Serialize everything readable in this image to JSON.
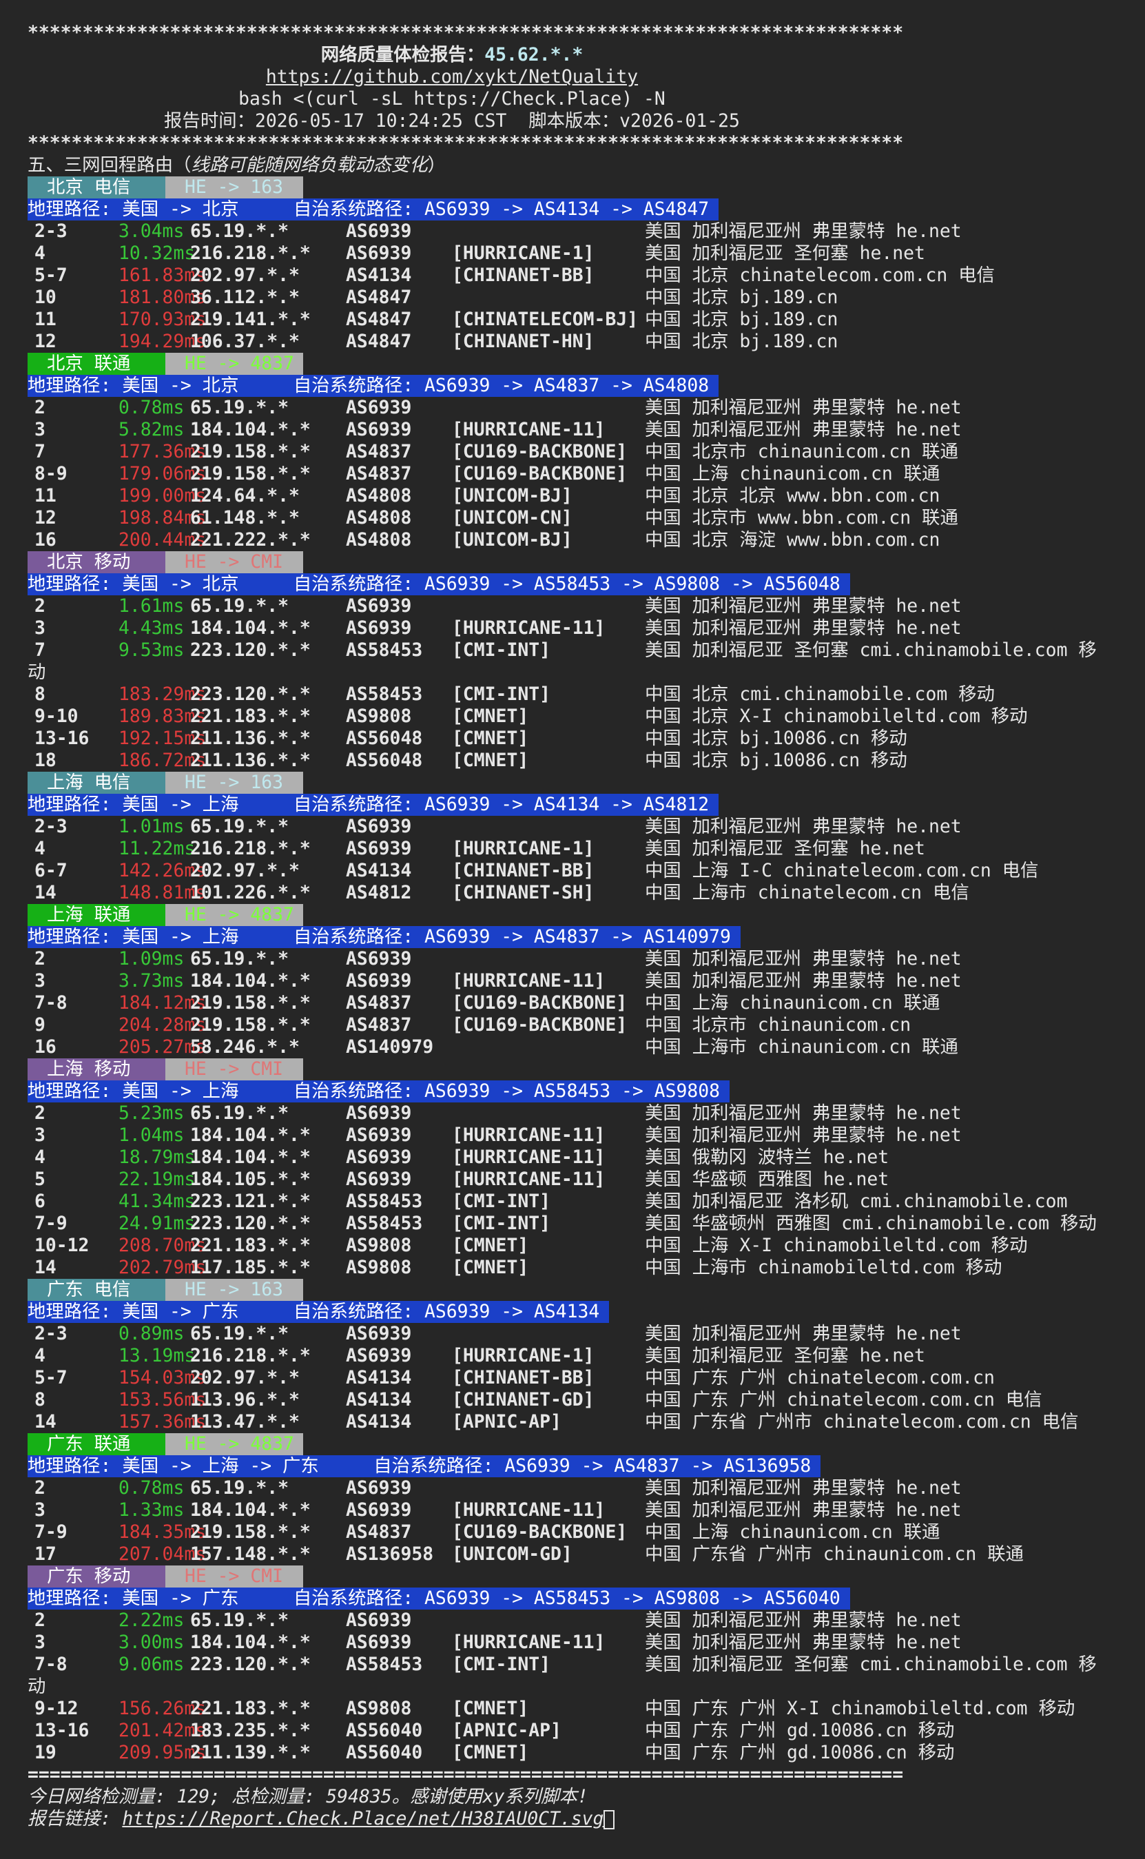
{
  "header": {
    "stars": "********************************************************************************",
    "title_label": "网络质量体检报告：",
    "title_ip": "45.62.*.*",
    "repo_link": "https://github.com/xykt/NetQuality",
    "command": "bash <(curl -sL https://Check.Place) -N",
    "report_time_label": "报告时间：",
    "report_time": "2026-05-17 10:24:25 CST",
    "script_version_label": "脚本版本：",
    "script_version": "v2026-01-25",
    "section_title": "五、三网回程路由（",
    "section_title_note": "线路可能随网络负载动态变化",
    "section_title_end": "）"
  },
  "routes": [
    {
      "location": "北京 电信",
      "isp": "HE -> 163",
      "type": "dx",
      "path": "地理路径: 美国 -> 北京     自治系统路径: AS6939 -> AS4134 -> AS4847",
      "hops": [
        {
          "hop": "2-3",
          "lat": "3.04ms",
          "hi": false,
          "ip": "65.19.*.*",
          "asn": "AS6939",
          "tag": "",
          "geo": "美国 加利福尼亚州 弗里蒙特 he.net"
        },
        {
          "hop": "4",
          "lat": "10.32ms",
          "hi": false,
          "ip": "216.218.*.*",
          "asn": "AS6939",
          "tag": "[HURRICANE-1]",
          "geo": "美国 加利福尼亚 圣何塞 he.net"
        },
        {
          "hop": "5-7",
          "lat": "161.83ms",
          "hi": true,
          "ip": "202.97.*.*",
          "asn": "AS4134",
          "tag": "[CHINANET-BB]",
          "geo": "中国 北京 chinatelecom.com.cn 电信"
        },
        {
          "hop": "10",
          "lat": "181.80ms",
          "hi": true,
          "ip": "36.112.*.*",
          "asn": "AS4847",
          "tag": "",
          "geo": "中国 北京 bj.189.cn"
        },
        {
          "hop": "11",
          "lat": "170.93ms",
          "hi": true,
          "ip": "219.141.*.*",
          "asn": "AS4847",
          "tag": "[CHINATELECOM-BJ]",
          "geo": "中国 北京 bj.189.cn"
        },
        {
          "hop": "12",
          "lat": "194.29ms",
          "hi": true,
          "ip": "106.37.*.*",
          "asn": "AS4847",
          "tag": "[CHINANET-HN]",
          "geo": "中国 北京 bj.189.cn"
        }
      ]
    },
    {
      "location": "北京 联通",
      "isp": "HE -> 4837",
      "type": "lt",
      "path": "地理路径: 美国 -> 北京     自治系统路径: AS6939 -> AS4837 -> AS4808",
      "hops": [
        {
          "hop": "2",
          "lat": "0.78ms",
          "hi": false,
          "ip": "65.19.*.*",
          "asn": "AS6939",
          "tag": "",
          "geo": "美国 加利福尼亚州 弗里蒙特 he.net"
        },
        {
          "hop": "3",
          "lat": "5.82ms",
          "hi": false,
          "ip": "184.104.*.*",
          "asn": "AS6939",
          "tag": "[HURRICANE-11]",
          "geo": "美国 加利福尼亚州 弗里蒙特 he.net"
        },
        {
          "hop": "7",
          "lat": "177.36ms",
          "hi": true,
          "ip": "219.158.*.*",
          "asn": "AS4837",
          "tag": "[CU169-BACKBONE]",
          "geo": "中国 北京市 chinaunicom.cn 联通"
        },
        {
          "hop": "8-9",
          "lat": "179.06ms",
          "hi": true,
          "ip": "219.158.*.*",
          "asn": "AS4837",
          "tag": "[CU169-BACKBONE]",
          "geo": "中国 上海 chinaunicom.cn 联通"
        },
        {
          "hop": "11",
          "lat": "199.00ms",
          "hi": true,
          "ip": "124.64.*.*",
          "asn": "AS4808",
          "tag": "[UNICOM-BJ]",
          "geo": "中国 北京 北京 www.bbn.com.cn"
        },
        {
          "hop": "12",
          "lat": "198.84ms",
          "hi": true,
          "ip": "61.148.*.*",
          "asn": "AS4808",
          "tag": "[UNICOM-CN]",
          "geo": "中国 北京市 www.bbn.com.cn 联通"
        },
        {
          "hop": "16",
          "lat": "200.44ms",
          "hi": true,
          "ip": "221.222.*.*",
          "asn": "AS4808",
          "tag": "[UNICOM-BJ]",
          "geo": "中国 北京 海淀 www.bbn.com.cn"
        }
      ]
    },
    {
      "location": "北京 移动",
      "isp": "HE -> CMI",
      "type": "yd",
      "path": "地理路径: 美国 -> 北京     自治系统路径: AS6939 -> AS58453 -> AS9808 -> AS56048",
      "hops": [
        {
          "hop": "2",
          "lat": "1.61ms",
          "hi": false,
          "ip": "65.19.*.*",
          "asn": "AS6939",
          "tag": "",
          "geo": "美国 加利福尼亚州 弗里蒙特 he.net"
        },
        {
          "hop": "3",
          "lat": "4.43ms",
          "hi": false,
          "ip": "184.104.*.*",
          "asn": "AS6939",
          "tag": "[HURRICANE-11]",
          "geo": "美国 加利福尼亚州 弗里蒙特 he.net"
        },
        {
          "hop": "7",
          "lat": "9.53ms",
          "hi": false,
          "ip": "223.120.*.*",
          "asn": "AS58453",
          "tag": "[CMI-INT]",
          "geo": "美国 加利福尼亚 圣何塞 cmi.chinamobile.com 移",
          "wrap": "动"
        },
        {
          "hop": "8",
          "lat": "183.29ms",
          "hi": true,
          "ip": "223.120.*.*",
          "asn": "AS58453",
          "tag": "[CMI-INT]",
          "geo": "中国 北京 cmi.chinamobile.com 移动"
        },
        {
          "hop": "9-10",
          "lat": "189.83ms",
          "hi": true,
          "ip": "221.183.*.*",
          "asn": "AS9808",
          "tag": "[CMNET]",
          "geo": "中国 北京 X-I chinamobileltd.com 移动"
        },
        {
          "hop": "13-16",
          "lat": "192.15ms",
          "hi": true,
          "ip": "211.136.*.*",
          "asn": "AS56048",
          "tag": "[CMNET]",
          "geo": "中国 北京 bj.10086.cn 移动"
        },
        {
          "hop": "18",
          "lat": "186.72ms",
          "hi": true,
          "ip": "211.136.*.*",
          "asn": "AS56048",
          "tag": "[CMNET]",
          "geo": "中国 北京 bj.10086.cn 移动"
        }
      ]
    },
    {
      "location": "上海 电信",
      "isp": "HE -> 163",
      "type": "dx",
      "path": "地理路径: 美国 -> 上海     自治系统路径: AS6939 -> AS4134 -> AS4812",
      "hops": [
        {
          "hop": "2-3",
          "lat": "1.01ms",
          "hi": false,
          "ip": "65.19.*.*",
          "asn": "AS6939",
          "tag": "",
          "geo": "美国 加利福尼亚州 弗里蒙特 he.net"
        },
        {
          "hop": "4",
          "lat": "11.22ms",
          "hi": false,
          "ip": "216.218.*.*",
          "asn": "AS6939",
          "tag": "[HURRICANE-1]",
          "geo": "美国 加利福尼亚 圣何塞 he.net"
        },
        {
          "hop": "6-7",
          "lat": "142.26ms",
          "hi": true,
          "ip": "202.97.*.*",
          "asn": "AS4134",
          "tag": "[CHINANET-BB]",
          "geo": "中国 上海 I-C chinatelecom.com.cn 电信"
        },
        {
          "hop": "14",
          "lat": "148.81ms",
          "hi": true,
          "ip": "101.226.*.*",
          "asn": "AS4812",
          "tag": "[CHINANET-SH]",
          "geo": "中国 上海市 chinatelecom.cn 电信"
        }
      ]
    },
    {
      "location": "上海 联通",
      "isp": "HE -> 4837",
      "type": "lt",
      "path": "地理路径: 美国 -> 上海     自治系统路径: AS6939 -> AS4837 -> AS140979",
      "hops": [
        {
          "hop": "2",
          "lat": "1.09ms",
          "hi": false,
          "ip": "65.19.*.*",
          "asn": "AS6939",
          "tag": "",
          "geo": "美国 加利福尼亚州 弗里蒙特 he.net"
        },
        {
          "hop": "3",
          "lat": "3.73ms",
          "hi": false,
          "ip": "184.104.*.*",
          "asn": "AS6939",
          "tag": "[HURRICANE-11]",
          "geo": "美国 加利福尼亚州 弗里蒙特 he.net"
        },
        {
          "hop": "7-8",
          "lat": "184.12ms",
          "hi": true,
          "ip": "219.158.*.*",
          "asn": "AS4837",
          "tag": "[CU169-BACKBONE]",
          "geo": "中国 上海 chinaunicom.cn 联通"
        },
        {
          "hop": "9",
          "lat": "204.28ms",
          "hi": true,
          "ip": "219.158.*.*",
          "asn": "AS4837",
          "tag": "[CU169-BACKBONE]",
          "geo": "中国 北京市 chinaunicom.cn"
        },
        {
          "hop": "16",
          "lat": "205.27ms",
          "hi": true,
          "ip": "58.246.*.*",
          "asn": "AS140979",
          "tag": "",
          "geo": "中国 上海市 chinaunicom.cn 联通"
        }
      ]
    },
    {
      "location": "上海 移动",
      "isp": "HE -> CMI",
      "type": "yd",
      "path": "地理路径: 美国 -> 上海     自治系统路径: AS6939 -> AS58453 -> AS9808",
      "hops": [
        {
          "hop": "2",
          "lat": "5.23ms",
          "hi": false,
          "ip": "65.19.*.*",
          "asn": "AS6939",
          "tag": "",
          "geo": "美国 加利福尼亚州 弗里蒙特 he.net"
        },
        {
          "hop": "3",
          "lat": "1.04ms",
          "hi": false,
          "ip": "184.104.*.*",
          "asn": "AS6939",
          "tag": "[HURRICANE-11]",
          "geo": "美国 加利福尼亚州 弗里蒙特 he.net"
        },
        {
          "hop": "4",
          "lat": "18.79ms",
          "hi": false,
          "ip": "184.104.*.*",
          "asn": "AS6939",
          "tag": "[HURRICANE-11]",
          "geo": "美国 俄勒冈 波特兰 he.net"
        },
        {
          "hop": "5",
          "lat": "22.19ms",
          "hi": false,
          "ip": "184.105.*.*",
          "asn": "AS6939",
          "tag": "[HURRICANE-11]",
          "geo": "美国 华盛顿 西雅图 he.net"
        },
        {
          "hop": "6",
          "lat": "41.34ms",
          "hi": false,
          "ip": "223.121.*.*",
          "asn": "AS58453",
          "tag": "[CMI-INT]",
          "geo": "美国 加利福尼亚 洛杉矶 cmi.chinamobile.com"
        },
        {
          "hop": "7-9",
          "lat": "24.91ms",
          "hi": false,
          "ip": "223.120.*.*",
          "asn": "AS58453",
          "tag": "[CMI-INT]",
          "geo": "美国 华盛顿州 西雅图 cmi.chinamobile.com 移动"
        },
        {
          "hop": "10-12",
          "lat": "208.70ms",
          "hi": true,
          "ip": "221.183.*.*",
          "asn": "AS9808",
          "tag": "[CMNET]",
          "geo": "中国 上海 X-I chinamobileltd.com 移动"
        },
        {
          "hop": "14",
          "lat": "202.79ms",
          "hi": true,
          "ip": "117.185.*.*",
          "asn": "AS9808",
          "tag": "[CMNET]",
          "geo": "中国 上海市 chinamobileltd.com 移动"
        }
      ]
    },
    {
      "location": "广东 电信",
      "isp": "HE -> 163",
      "type": "dx",
      "path": "地理路径: 美国 -> 广东     自治系统路径: AS6939 -> AS4134",
      "hops": [
        {
          "hop": "2-3",
          "lat": "0.89ms",
          "hi": false,
          "ip": "65.19.*.*",
          "asn": "AS6939",
          "tag": "",
          "geo": "美国 加利福尼亚州 弗里蒙特 he.net"
        },
        {
          "hop": "4",
          "lat": "13.19ms",
          "hi": false,
          "ip": "216.218.*.*",
          "asn": "AS6939",
          "tag": "[HURRICANE-1]",
          "geo": "美国 加利福尼亚 圣何塞 he.net"
        },
        {
          "hop": "5-7",
          "lat": "154.03ms",
          "hi": true,
          "ip": "202.97.*.*",
          "asn": "AS4134",
          "tag": "[CHINANET-BB]",
          "geo": "中国 广东 广州 chinatelecom.com.cn"
        },
        {
          "hop": "8",
          "lat": "153.56ms",
          "hi": true,
          "ip": "113.96.*.*",
          "asn": "AS4134",
          "tag": "[CHINANET-GD]",
          "geo": "中国 广东 广州 chinatelecom.com.cn 电信"
        },
        {
          "hop": "14",
          "lat": "157.36ms",
          "hi": true,
          "ip": "113.47.*.*",
          "asn": "AS4134",
          "tag": "[APNIC-AP]",
          "geo": "中国 广东省 广州市 chinatelecom.com.cn 电信"
        }
      ]
    },
    {
      "location": "广东 联通",
      "isp": "HE -> 4837",
      "type": "lt",
      "path": "地理路径: 美国 -> 上海 -> 广东     自治系统路径: AS6939 -> AS4837 -> AS136958",
      "hops": [
        {
          "hop": "2",
          "lat": "0.78ms",
          "hi": false,
          "ip": "65.19.*.*",
          "asn": "AS6939",
          "tag": "",
          "geo": "美国 加利福尼亚州 弗里蒙特 he.net"
        },
        {
          "hop": "3",
          "lat": "1.33ms",
          "hi": false,
          "ip": "184.104.*.*",
          "asn": "AS6939",
          "tag": "[HURRICANE-11]",
          "geo": "美国 加利福尼亚州 弗里蒙特 he.net"
        },
        {
          "hop": "7-9",
          "lat": "184.35ms",
          "hi": true,
          "ip": "219.158.*.*",
          "asn": "AS4837",
          "tag": "[CU169-BACKBONE]",
          "geo": "中国 上海 chinaunicom.cn 联通"
        },
        {
          "hop": "17",
          "lat": "207.04ms",
          "hi": true,
          "ip": "157.148.*.*",
          "asn": "AS136958",
          "tag": "[UNICOM-GD]",
          "geo": "中国 广东省 广州市 chinaunicom.cn 联通"
        }
      ]
    },
    {
      "location": "广东 移动",
      "isp": "HE -> CMI",
      "type": "yd",
      "path": "地理路径: 美国 -> 广东     自治系统路径: AS6939 -> AS58453 -> AS9808 -> AS56040",
      "hops": [
        {
          "hop": "2",
          "lat": "2.22ms",
          "hi": false,
          "ip": "65.19.*.*",
          "asn": "AS6939",
          "tag": "",
          "geo": "美国 加利福尼亚州 弗里蒙特 he.net"
        },
        {
          "hop": "3",
          "lat": "3.00ms",
          "hi": false,
          "ip": "184.104.*.*",
          "asn": "AS6939",
          "tag": "[HURRICANE-11]",
          "geo": "美国 加利福尼亚州 弗里蒙特 he.net"
        },
        {
          "hop": "7-8",
          "lat": "9.06ms",
          "hi": false,
          "ip": "223.120.*.*",
          "asn": "AS58453",
          "tag": "[CMI-INT]",
          "geo": "美国 加利福尼亚 圣何塞 cmi.chinamobile.com 移",
          "wrap": "动"
        },
        {
          "hop": "9-12",
          "lat": "156.26ms",
          "hi": true,
          "ip": "221.183.*.*",
          "asn": "AS9808",
          "tag": "[CMNET]",
          "geo": "中国 广东 广州 X-I chinamobileltd.com 移动"
        },
        {
          "hop": "13-16",
          "lat": "201.42ms",
          "hi": true,
          "ip": "183.235.*.*",
          "asn": "AS56040",
          "tag": "[APNIC-AP]",
          "geo": "中国 广东 广州 gd.10086.cn 移动"
        },
        {
          "hop": "19",
          "lat": "209.95ms",
          "hi": true,
          "ip": "211.139.*.*",
          "asn": "AS56040",
          "tag": "[CMNET]",
          "geo": "中国 广东 广州 gd.10086.cn 移动"
        }
      ]
    }
  ],
  "footer": {
    "equals": "================================================================================",
    "stats": "今日网络检测量: 129; 总检测量: 594835。感谢使用xy系列脚本!",
    "report_label": "报告链接: ",
    "report_link": "https://Report.Check.Place/net/H38IAU0CT.svg"
  },
  "colors": {
    "background": "#262626",
    "path_bar": "#1b40c8",
    "latency_low": "#38c838",
    "latency_high": "#e03c3c"
  }
}
